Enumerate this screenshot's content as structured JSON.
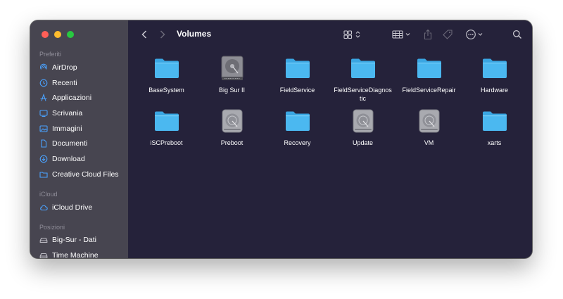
{
  "window": {
    "title": "Volumes"
  },
  "sidebar": {
    "sections": [
      {
        "label": "Preferiti",
        "items": [
          {
            "label": "AirDrop",
            "icon": "airdrop-icon"
          },
          {
            "label": "Recenti",
            "icon": "clock-icon"
          },
          {
            "label": "Applicazioni",
            "icon": "applications-icon"
          },
          {
            "label": "Scrivania",
            "icon": "desktop-icon"
          },
          {
            "label": "Immagini",
            "icon": "photo-icon"
          },
          {
            "label": "Documenti",
            "icon": "document-icon"
          },
          {
            "label": "Download",
            "icon": "download-icon"
          },
          {
            "label": "Creative Cloud Files",
            "icon": "folder-icon"
          }
        ]
      },
      {
        "label": "iCloud",
        "items": [
          {
            "label": "iCloud Drive",
            "icon": "cloud-icon"
          }
        ]
      },
      {
        "label": "Posizioni",
        "items": [
          {
            "label": "Big-Sur - Dati",
            "icon": "drive-icon"
          },
          {
            "label": "Time Machine",
            "icon": "drive-icon"
          }
        ]
      }
    ]
  },
  "toolbar": {
    "back": "chevron-left-icon",
    "forward": "chevron-right-icon",
    "view_mode": "icon-grid-icon",
    "group": "group-icon",
    "share": "share-icon",
    "tag": "tag-icon",
    "more": "ellipsis-icon",
    "search": "search-icon"
  },
  "items": [
    {
      "label": "BaseSystem",
      "kind": "folder"
    },
    {
      "label": "Big Sur II",
      "kind": "disk"
    },
    {
      "label": "FieldService",
      "kind": "folder"
    },
    {
      "label": "FieldServiceDiagnostic",
      "kind": "folder"
    },
    {
      "label": "FieldServiceRepair",
      "kind": "folder"
    },
    {
      "label": "Hardware",
      "kind": "folder"
    },
    {
      "label": "iSCPreboot",
      "kind": "folder"
    },
    {
      "label": "Preboot",
      "kind": "volume"
    },
    {
      "label": "Recovery",
      "kind": "folder"
    },
    {
      "label": "Update",
      "kind": "volume"
    },
    {
      "label": "VM",
      "kind": "volume"
    },
    {
      "label": "xarts",
      "kind": "folder"
    }
  ],
  "colors": {
    "sidebar_bg": "#474550",
    "main_bg": "#25223a",
    "folder": "#4bb8f0",
    "sidebar_icon": "#4aa2ff",
    "close": "#ff5f57",
    "minimize": "#febc2e",
    "zoom": "#28c840"
  }
}
